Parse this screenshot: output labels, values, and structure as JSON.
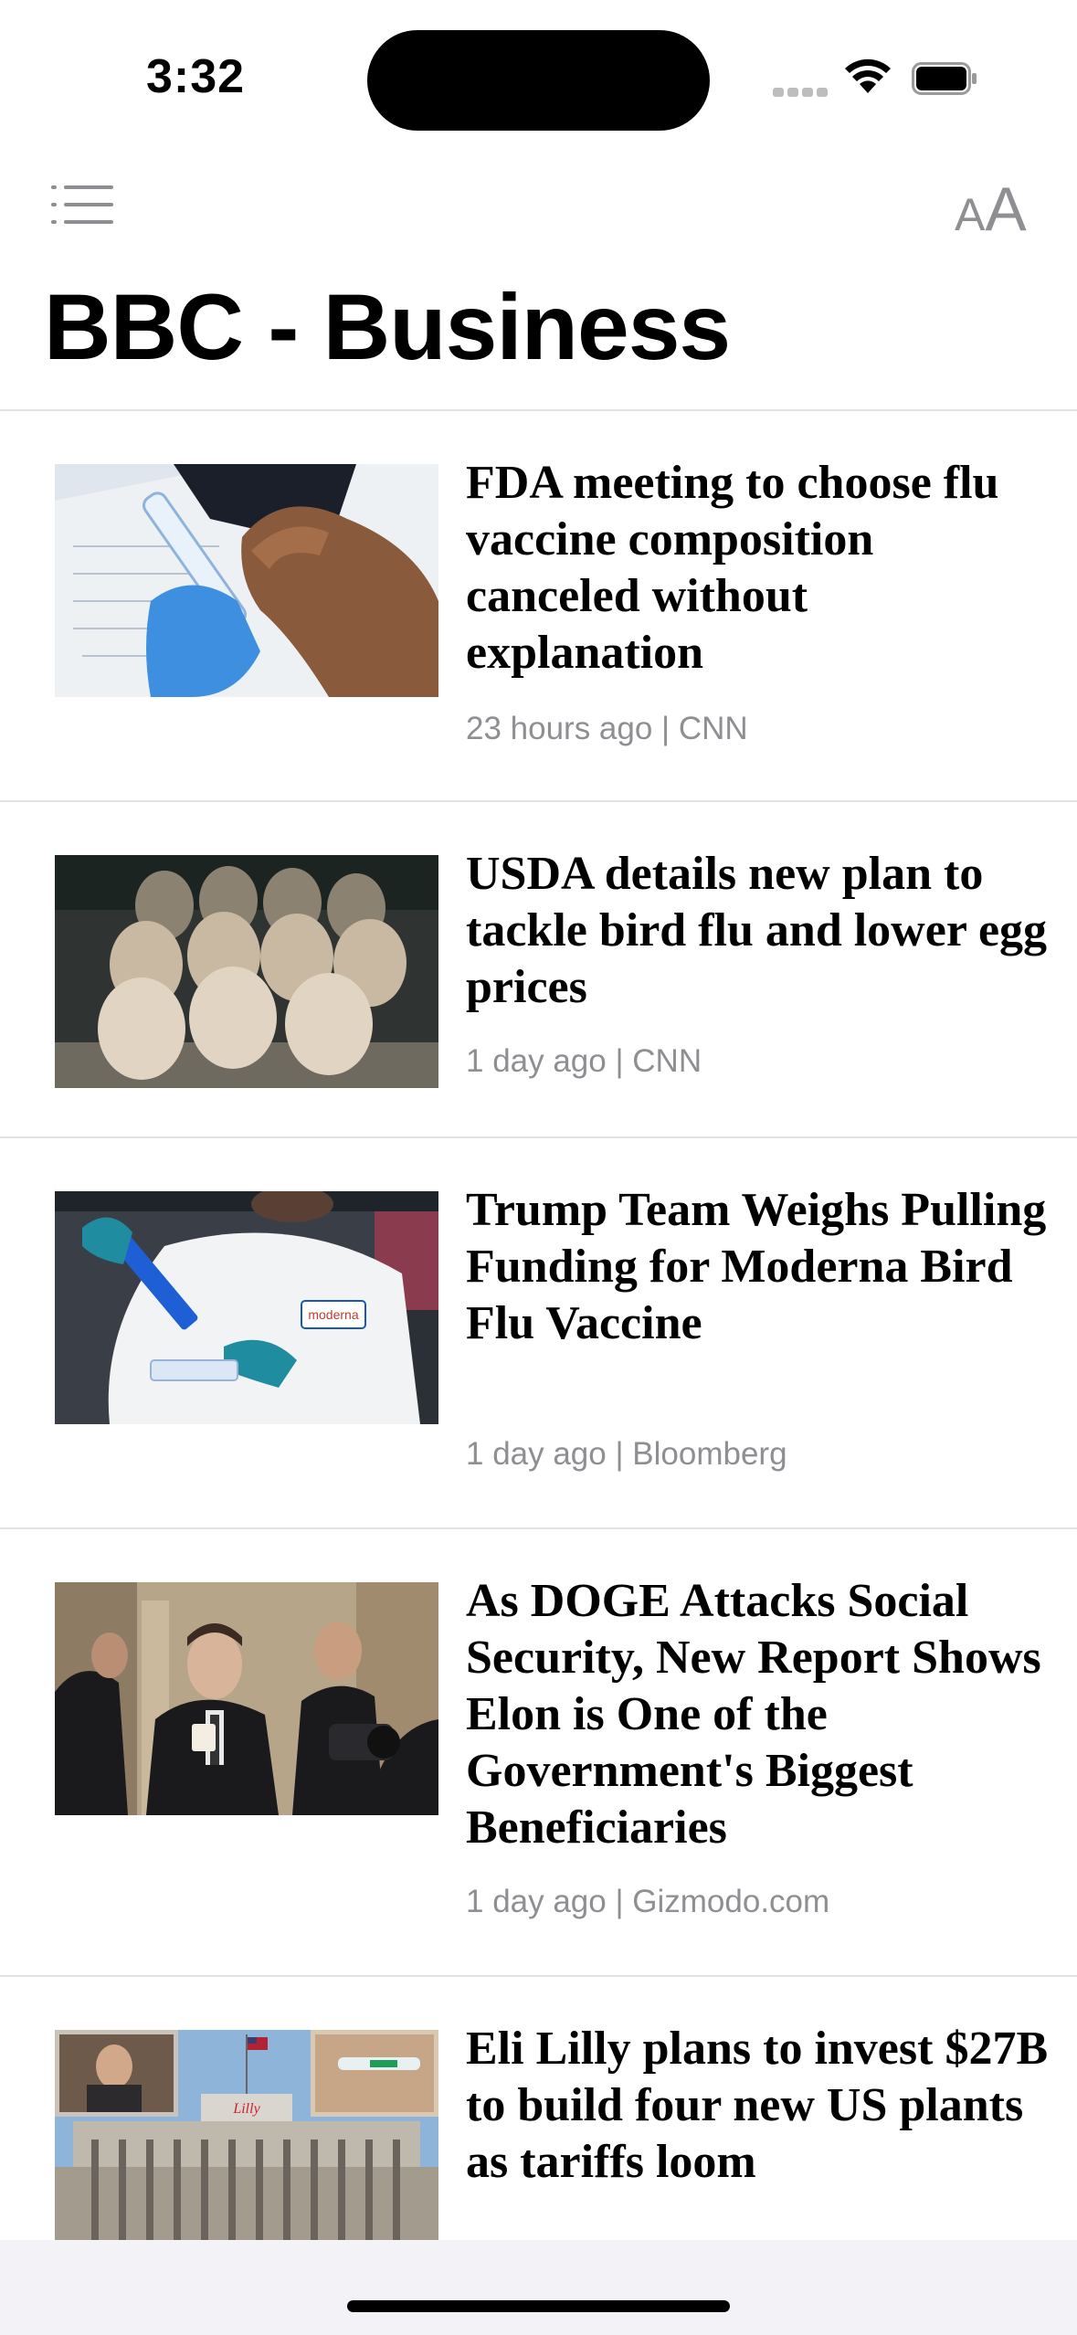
{
  "status_bar": {
    "time": "3:32"
  },
  "toolbar": {
    "text_size_small": "A",
    "text_size_large": "A"
  },
  "feed_title": "BBC - Business",
  "articles": [
    {
      "headline": "FDA meeting to choose flu vaccine composition canceled without explanation",
      "meta": "23 hours ago | CNN"
    },
    {
      "headline": "USDA details new plan to tackle bird flu and lower egg prices",
      "meta": "1 day ago | CNN"
    },
    {
      "headline": "Trump Team Weighs Pulling Funding for Moderna Bird Flu Vaccine",
      "meta": "1 day ago | Bloomberg"
    },
    {
      "headline": "As DOGE Attacks Social Security, New Report Shows Elon is One of the Government's Biggest Beneficiaries",
      "meta": "1 day ago | Gizmodo.com"
    },
    {
      "headline": "Eli Lilly plans to invest $27B to build four new US plants as tariffs loom",
      "meta": ""
    }
  ],
  "image_labels": {
    "moderna_badge": "moderna",
    "lilly_sign": "Lilly"
  },
  "colors": {
    "secondary_text": "#8e8e93",
    "divider": "#e2e2e2",
    "home_bg": "#f2f2f7"
  }
}
